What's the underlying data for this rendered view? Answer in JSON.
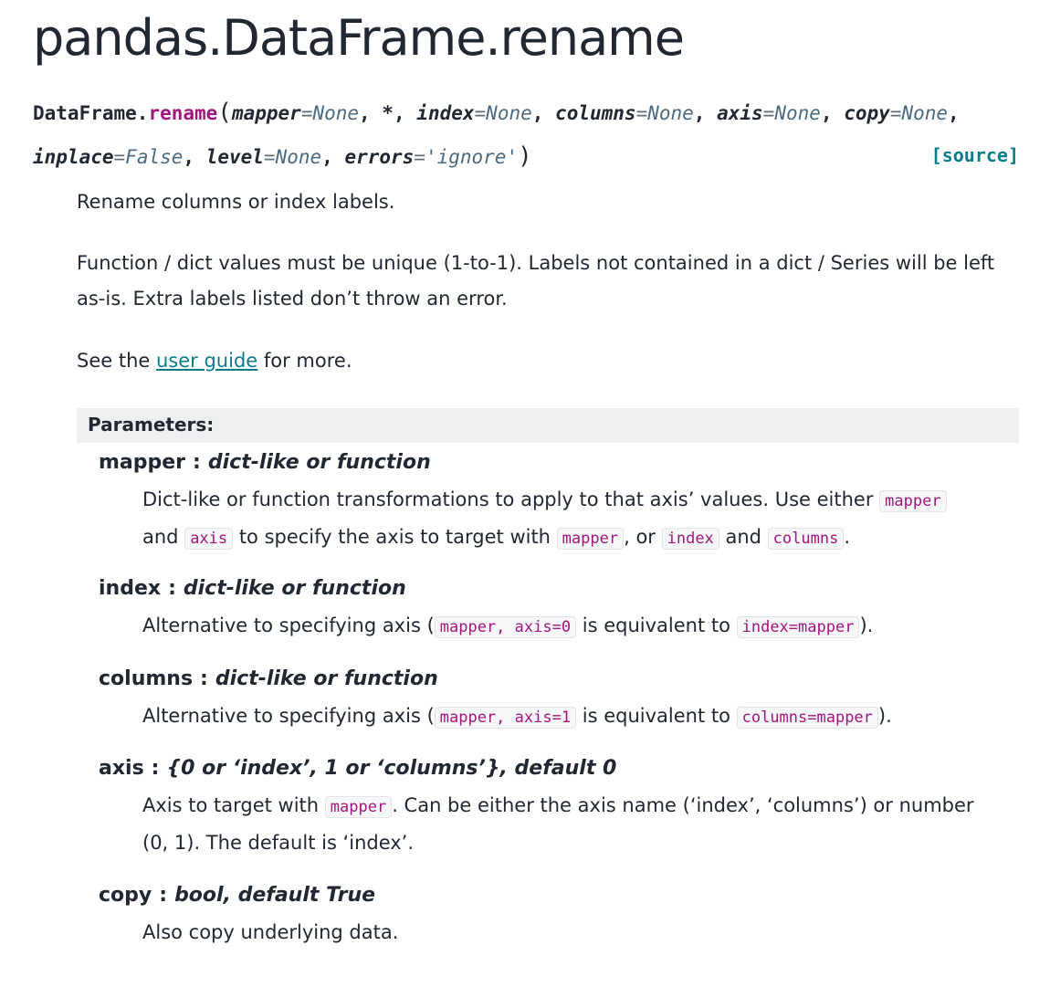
{
  "title": "pandas.DataFrame.rename",
  "signature": {
    "class": "DataFrame.",
    "func": "rename",
    "open": "(",
    "close": ")",
    "params_line1": [
      {
        "name": "mapper",
        "eq": "=",
        "default": "None",
        "sep": ", "
      },
      {
        "name": "*",
        "eq": "",
        "default": "",
        "sep": ", "
      },
      {
        "name": "index",
        "eq": "=",
        "default": "None",
        "sep": ", "
      },
      {
        "name": "columns",
        "eq": "=",
        "default": "None",
        "sep": ", "
      },
      {
        "name": "axis",
        "eq": "=",
        "default": "None",
        "sep": ", "
      },
      {
        "name": "copy",
        "eq": "=",
        "default": "None",
        "sep": ","
      }
    ],
    "params_line2": [
      {
        "name": "inplace",
        "eq": "=",
        "default": "False",
        "sep": ", "
      },
      {
        "name": "level",
        "eq": "=",
        "default": "None",
        "sep": ", "
      },
      {
        "name": "errors",
        "eq": "=",
        "default": "'ignore'",
        "sep": ""
      }
    ],
    "source_label": "[source]"
  },
  "summary": "Rename columns or index labels.",
  "description": "Function / dict values must be unique (1-to-1). Labels not contained in a dict / Series will be left as-is. Extra labels listed don’t throw an error.",
  "see_also": {
    "before": "See the ",
    "link": "user guide",
    "after": " for more."
  },
  "parameters_header": "Parameters:",
  "parameters": [
    {
      "name": "mapper",
      "type": "dict-like or function",
      "desc": [
        {
          "t": "Dict-like or function transformations to apply to that axis’ values. Use either "
        },
        {
          "c": "mapper"
        },
        {
          "t": " and "
        },
        {
          "c": "axis"
        },
        {
          "t": " to specify the axis to target with "
        },
        {
          "c": "mapper"
        },
        {
          "t": ", or "
        },
        {
          "c": "index"
        },
        {
          "t": " and "
        },
        {
          "c": "columns"
        },
        {
          "t": "."
        }
      ]
    },
    {
      "name": "index",
      "type": "dict-like or function",
      "desc": [
        {
          "t": "Alternative to specifying axis ("
        },
        {
          "c": "mapper, axis=0"
        },
        {
          "t": " is equivalent to "
        },
        {
          "c": "index=mapper"
        },
        {
          "t": ")."
        }
      ]
    },
    {
      "name": "columns",
      "type": "dict-like or function",
      "desc": [
        {
          "t": "Alternative to specifying axis ("
        },
        {
          "c": "mapper, axis=1"
        },
        {
          "t": " is equivalent to "
        },
        {
          "c": "columns=mapper"
        },
        {
          "t": ")."
        }
      ]
    },
    {
      "name": "axis",
      "type": "{0 or ‘index’, 1 or ‘columns’}, default 0",
      "desc": [
        {
          "t": "Axis to target with "
        },
        {
          "c": "mapper"
        },
        {
          "t": ". Can be either the axis name (‘index’, ‘columns’) or number (0, 1). The default is ‘index’."
        }
      ]
    },
    {
      "name": "copy",
      "type": "bool, default True",
      "desc": [
        {
          "t": "Also copy underlying data."
        }
      ]
    }
  ]
}
